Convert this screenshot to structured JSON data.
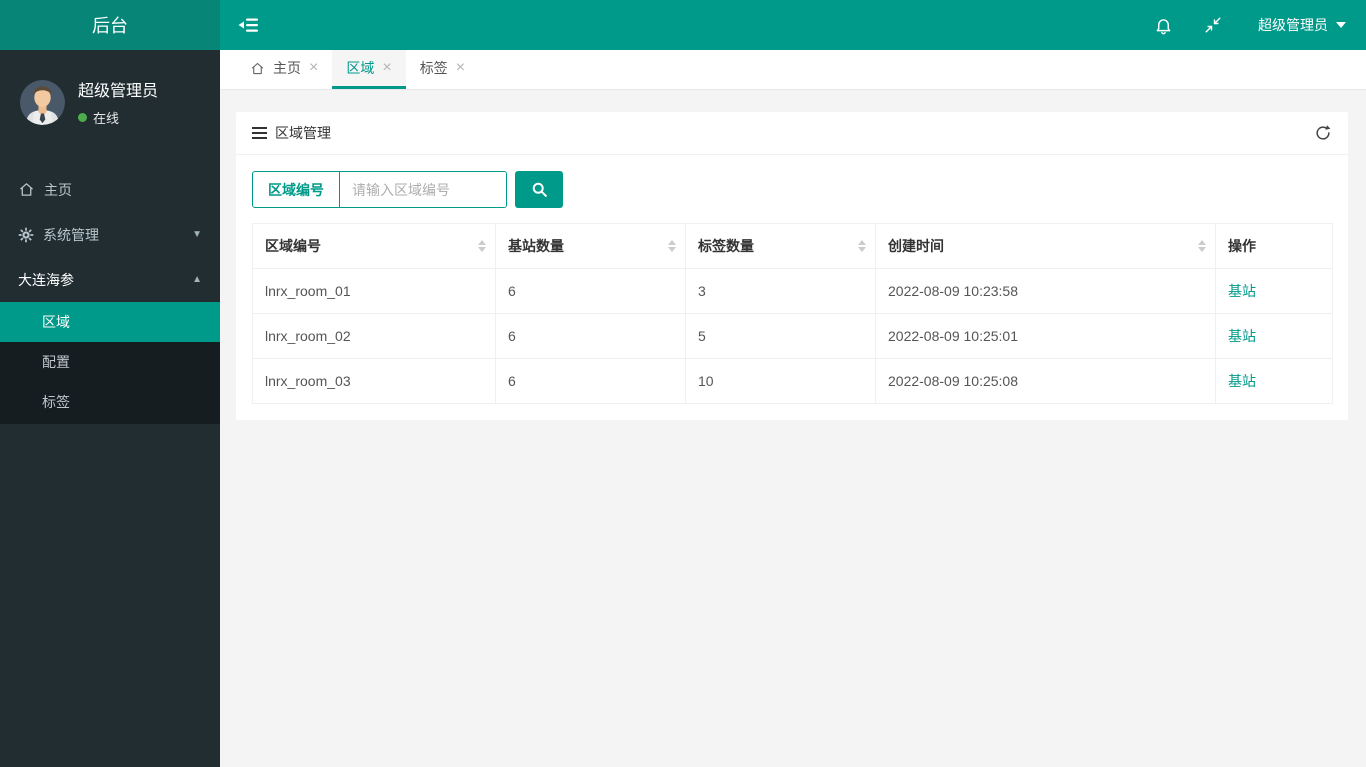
{
  "header": {
    "logo_text": "后台",
    "user_menu_label": "超级管理员"
  },
  "sidebar": {
    "user": {
      "name": "超级管理员",
      "status": "在线"
    },
    "menu": [
      {
        "label": "主页",
        "icon": "home-icon"
      },
      {
        "label": "系统管理",
        "icon": "gear-icon",
        "caret": "down"
      },
      {
        "label": "大连海参",
        "caret": "up",
        "submenu": [
          {
            "label": "区域",
            "active": true
          },
          {
            "label": "配置",
            "active": false
          },
          {
            "label": "标签",
            "active": false
          }
        ]
      }
    ]
  },
  "tabs": [
    {
      "label": "主页",
      "icon": "home-icon",
      "active": false
    },
    {
      "label": "区域",
      "active": true
    },
    {
      "label": "标签",
      "active": false
    }
  ],
  "panel": {
    "title": "区域管理",
    "search": {
      "label": "区域编号",
      "placeholder": "请输入区域编号",
      "value": ""
    },
    "table": {
      "columns": [
        {
          "label": "区域编号",
          "sortable": true
        },
        {
          "label": "基站数量",
          "sortable": true
        },
        {
          "label": "标签数量",
          "sortable": true
        },
        {
          "label": "创建时间",
          "sortable": true
        },
        {
          "label": "操作",
          "sortable": false
        }
      ],
      "rows": [
        {
          "area": "lnrx_room_01",
          "stations": "6",
          "tags": "3",
          "created": "2022-08-09 10:23:58",
          "action": "基站"
        },
        {
          "area": "lnrx_room_02",
          "stations": "6",
          "tags": "5",
          "created": "2022-08-09 10:25:01",
          "action": "基站"
        },
        {
          "area": "lnrx_room_03",
          "stations": "6",
          "tags": "10",
          "created": "2022-08-09 10:25:08",
          "action": "基站"
        }
      ]
    }
  },
  "icons": {
    "close": "×",
    "caret_down": "▼",
    "caret_up": "▲"
  },
  "colors": {
    "accent_teal": "#009a8a",
    "logo_teal": "#078678",
    "sidebar_dark": "#222d32",
    "submenu_dark": "#161d21",
    "online_green": "#4cae4c",
    "content_bg": "#f4f4f4",
    "link_teal": "#009a8a"
  }
}
